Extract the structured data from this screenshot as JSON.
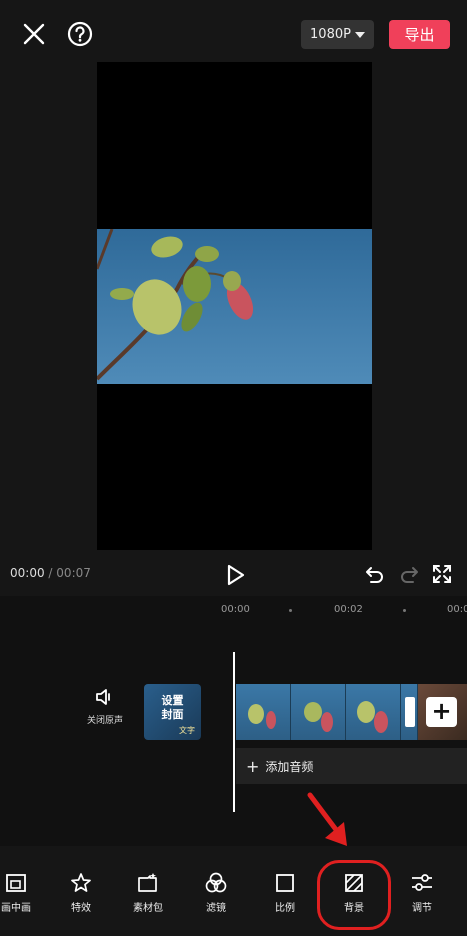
{
  "topbar": {
    "resolution": "1080P",
    "export_label": "导出"
  },
  "playback": {
    "current_time": "00:00",
    "separator": "/",
    "duration": "00:07"
  },
  "timeline": {
    "ruler": [
      "00:00",
      "00:02",
      "00:0"
    ],
    "mute_label": "关闭原声",
    "cover_label_line1": "设置",
    "cover_label_line2": "封面",
    "cover_sub": "文字",
    "add_clip": "+",
    "add_audio_label": "添加音频"
  },
  "toolbar": {
    "items": [
      {
        "label": "画中画",
        "icon": "picture-in-picture-icon"
      },
      {
        "label": "特效",
        "icon": "effects-star-icon"
      },
      {
        "label": "素材包",
        "icon": "material-pack-icon"
      },
      {
        "label": "滤镜",
        "icon": "filter-circles-icon"
      },
      {
        "label": "比例",
        "icon": "ratio-square-icon"
      },
      {
        "label": "背景",
        "icon": "background-hatch-icon"
      },
      {
        "label": "调节",
        "icon": "adjust-sliders-icon"
      }
    ]
  },
  "colors": {
    "accent": "#f0405a",
    "annotation": "#e02020"
  }
}
